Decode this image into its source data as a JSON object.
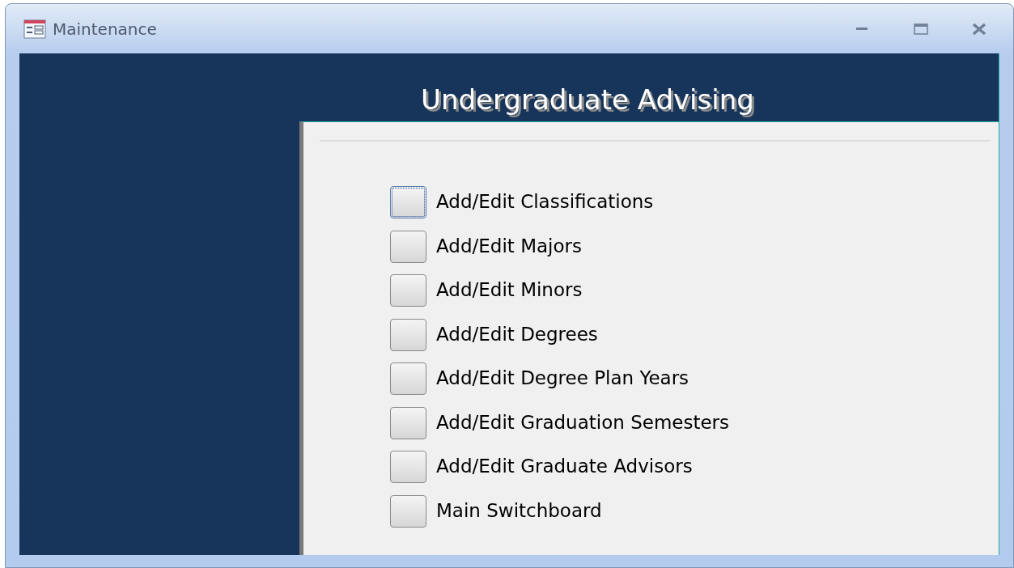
{
  "window": {
    "title": "Maintenance"
  },
  "heading": "Undergraduate Advising",
  "items": [
    {
      "label": "Add/Edit Classifications",
      "selected": true
    },
    {
      "label": "Add/Edit Majors",
      "selected": false
    },
    {
      "label": "Add/Edit Minors",
      "selected": false
    },
    {
      "label": "Add/Edit Degrees",
      "selected": false
    },
    {
      "label": "Add/Edit Degree Plan Years",
      "selected": false
    },
    {
      "label": "Add/Edit Graduation Semesters",
      "selected": false
    },
    {
      "label": "Add/Edit Graduate Advisors",
      "selected": false
    },
    {
      "label": "Main Switchboard",
      "selected": false
    }
  ]
}
